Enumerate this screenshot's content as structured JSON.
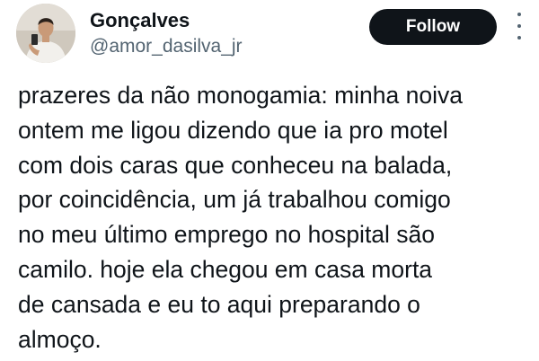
{
  "author": {
    "display_name": "Gonçalves",
    "handle": "@amor_dasilva_jr"
  },
  "actions": {
    "follow_label": "Follow",
    "more_icon": "more-vertical-icon"
  },
  "tweet": {
    "lines": [
      "prazeres da não monogamia: minha noiva",
      "ontem me ligou dizendo que ia pro motel",
      "com dois caras que conheceu na balada,",
      "por coincidência, um já trabalhou comigo",
      "no meu último emprego no hospital são",
      "camilo. hoje ela chegou em casa morta",
      "de cansada e eu to aqui preparando o",
      "almoço."
    ]
  },
  "colors": {
    "text": "#0f1419",
    "secondary_text": "#536471",
    "follow_button_bg": "#0f1419",
    "follow_button_text": "#ffffff"
  }
}
